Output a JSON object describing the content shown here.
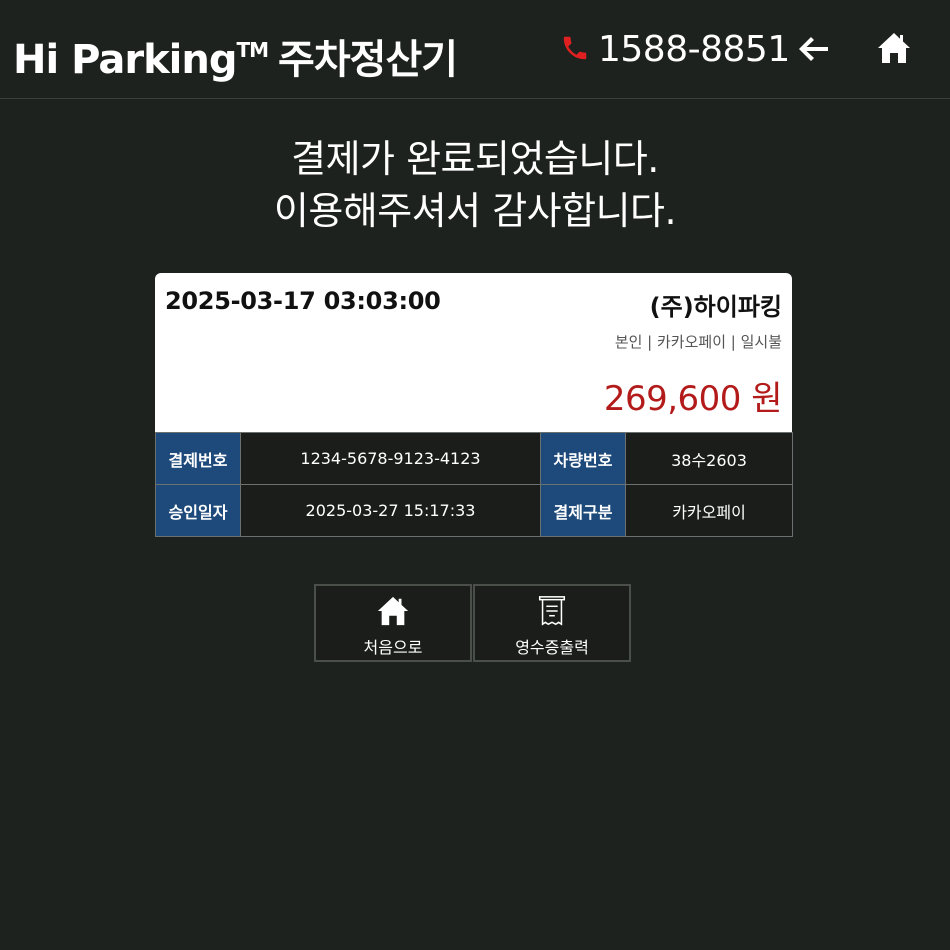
{
  "header": {
    "brand": "Hi Parking",
    "trademark": "TM",
    "subtitle": "주차정산기",
    "phone": "1588-8851",
    "phone_icon": "phone-icon",
    "back_icon": "arrow-left-icon",
    "home_icon": "home-icon"
  },
  "message": {
    "line1": "결제가 완료되었습니다.",
    "line2": "이용해주셔서 감사합니다."
  },
  "receipt": {
    "date": "2025-03-17 03:03:00",
    "merchant": "(주)하이파킹",
    "detail": "본인 | 카카오페이 | 일시불",
    "amount": "269,600 원",
    "amount_color": "#b31b1b"
  },
  "table": {
    "rows": [
      {
        "label1": "결제번호",
        "value1": "1234-5678-9123-4123",
        "label2": "차량번호",
        "value2": "38수2603"
      },
      {
        "label1": "승인일자",
        "value1": "2025-03-27 15:17:33",
        "label2": "결제구분",
        "value2": "카카오페이"
      }
    ],
    "header_color": "#1d4a7a"
  },
  "buttons": {
    "home_label": "처음으로",
    "home_icon": "home-icon",
    "receipt_label": "영수증출력",
    "receipt_icon": "receipt-icon"
  },
  "colors": {
    "background": "#1e221e",
    "phone_icon": "#e02020"
  }
}
